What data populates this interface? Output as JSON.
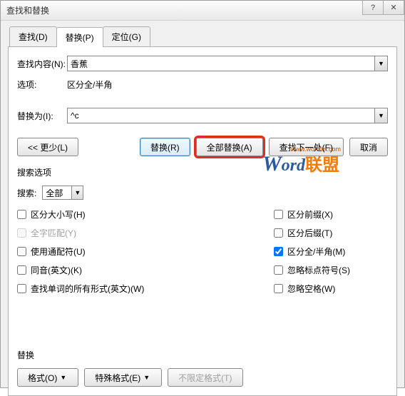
{
  "window": {
    "title": "查找和替换"
  },
  "tabs": {
    "find": "查找(D)",
    "replace": "替换(P)",
    "goto": "定位(G)"
  },
  "fields": {
    "find_label": "查找内容(N):",
    "find_value": "香蕉",
    "options_label": "选项:",
    "options_value": "区分全/半角",
    "replace_label": "替换为(I):",
    "replace_value": "^c"
  },
  "watermark": {
    "url": "www.wordlm.com",
    "w": "W",
    "ord": "ord",
    "cn": "联盟"
  },
  "buttons": {
    "less": "<< 更少(L)",
    "replace": "替换(R)",
    "replace_all": "全部替换(A)",
    "find_next": "查找下一处(F)",
    "cancel": "取消"
  },
  "search_options": {
    "title": "搜索选项",
    "search_label": "搜索:",
    "search_value": "全部",
    "match_case": "区分大小写(H)",
    "whole_word": "全字匹配(Y)",
    "wildcards": "使用通配符(U)",
    "sounds_like": "同音(英文)(K)",
    "all_forms": "查找单词的所有形式(英文)(W)",
    "match_prefix": "区分前缀(X)",
    "match_suffix": "区分后缀(T)",
    "full_half": "区分全/半角(M)",
    "ignore_punct": "忽略标点符号(S)",
    "ignore_space": "忽略空格(W)"
  },
  "bottom": {
    "title": "替换",
    "format": "格式(O)",
    "special": "特殊格式(E)",
    "no_format": "不限定格式(T)"
  }
}
